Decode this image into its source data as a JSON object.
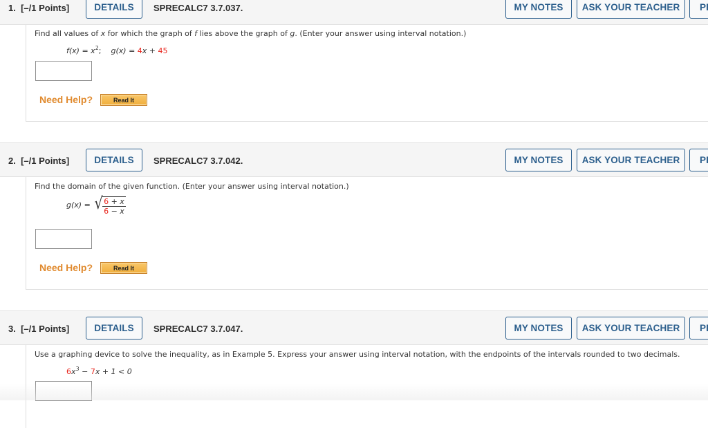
{
  "questions": [
    {
      "number": "1.",
      "points": "[–/1 Points]",
      "details_label": "DETAILS",
      "code": "SPRECALC7 3.7.037.",
      "my_notes_label": "MY NOTES",
      "ask_teacher_label": "ASK YOUR TEACHER",
      "practice_label": "PRACTICE ANOTHER",
      "prompt_parts": [
        "Find all values of ",
        "x",
        " for which the graph of ",
        "f",
        " lies above the graph of ",
        "g",
        ". (Enter your answer using interval notation.)"
      ],
      "math": {
        "f_label": "f(x) = x",
        "f_exp": "2",
        "separator": ";",
        "g_label": "g(x) = ",
        "g_coef": "4",
        "g_var": "x + ",
        "g_const": "45"
      },
      "answer_value": "",
      "need_help_label": "Need Help?",
      "read_it_label": "Read It"
    },
    {
      "number": "2.",
      "points": "[–/1 Points]",
      "details_label": "DETAILS",
      "code": "SPRECALC7 3.7.042.",
      "my_notes_label": "MY NOTES",
      "ask_teacher_label": "ASK YOUR TEACHER",
      "practice_label": "PRACTICE ANOTHER",
      "prompt": "Find the domain of the given function. (Enter your answer using interval notation.)",
      "math": {
        "g_label": "g(x) = ",
        "num_const": "6",
        "num_rest": " + x",
        "den_const": "6",
        "den_rest": " − x"
      },
      "answer_value": "",
      "need_help_label": "Need Help?",
      "read_it_label": "Read It"
    },
    {
      "number": "3.",
      "points": "[–/1 Points]",
      "details_label": "DETAILS",
      "code": "SPRECALC7 3.7.047.",
      "my_notes_label": "MY NOTES",
      "ask_teacher_label": "ASK YOUR TEACHER",
      "practice_label": "PRACTICE ANOTHER",
      "prompt": "Use a graphing device to solve the inequality, as in Example 5. Express your answer using interval notation, with the endpoints of the intervals rounded to two decimals.",
      "math": {
        "coef1": "6",
        "var1": "x",
        "exp1": "3",
        "op1": " − ",
        "coef2": "7",
        "rest": "x + 1 < 0"
      },
      "answer_value": ""
    }
  ],
  "colors": {
    "accent_blue": "#2c5f8d",
    "help_orange": "#e08a2e",
    "math_red": "#e8261d"
  }
}
